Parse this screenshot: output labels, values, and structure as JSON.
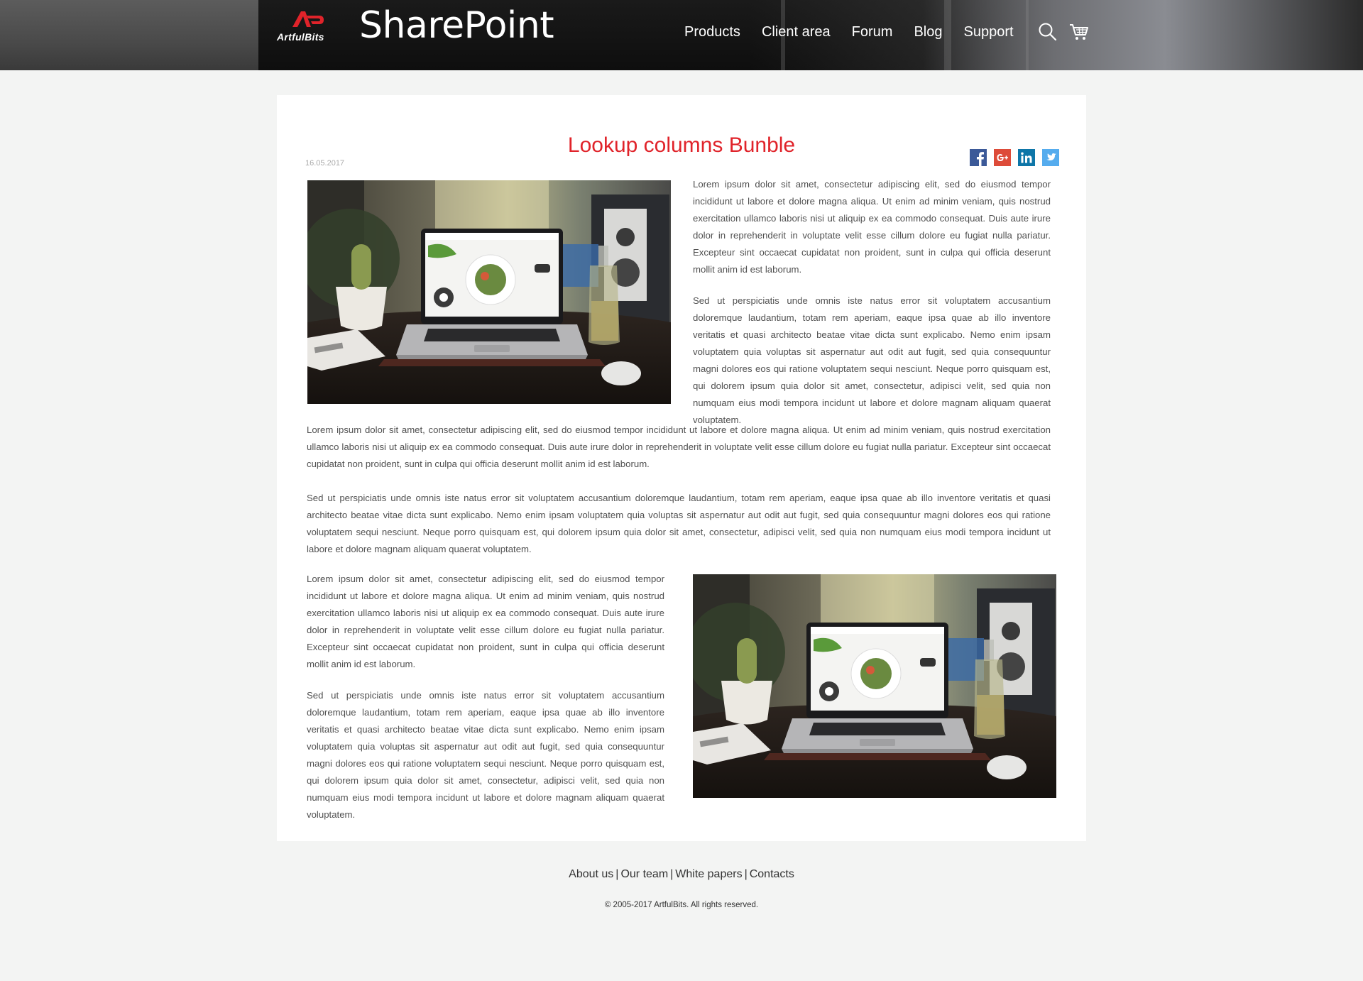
{
  "header": {
    "logo_text": "ArtfulBits",
    "site_title": "SharePoint",
    "nav": [
      "Products",
      "Client area",
      "Forum",
      "Blog",
      "Support"
    ]
  },
  "article": {
    "title": "Lookup columns Bunble",
    "date": "16.05.2017",
    "paragraphs": [
      "Lorem ipsum dolor sit amet, consectetur adipiscing elit, sed do eiusmod tempor incididunt ut labore et dolore magna aliqua. Ut enim ad minim veniam, quis nostrud exercitation ullamco laboris nisi ut aliquip ex ea commodo consequat. Duis aute irure dolor in reprehenderit in voluptate velit esse cillum dolore eu fugiat nulla pariatur. Excepteur sint occaecat cupidatat non proident, sunt in culpa qui officia deserunt mollit anim id est laborum.",
      "Sed ut perspiciatis unde omnis iste natus error sit voluptatem accusantium doloremque laudantium, totam rem aperiam, eaque ipsa quae ab illo inventore veritatis et quasi architecto beatae vitae dicta sunt explicabo. Nemo enim ipsam voluptatem quia voluptas sit aspernatur aut odit aut fugit, sed quia consequuntur magni dolores eos qui ratione voluptatem sequi nesciunt. Neque porro quisquam est, qui dolorem ipsum quia dolor sit amet, consectetur, adipisci velit, sed quia non numquam eius modi tempora incidunt ut labore et dolore magnam aliquam quaerat voluptatem.",
      "Lorem ipsum dolor sit amet, consectetur adipiscing elit, sed do eiusmod tempor incididunt ut labore et dolore magna aliqua. Ut enim ad minim veniam, quis nostrud exercitation ullamco laboris nisi ut aliquip ex ea commodo consequat. Duis aute irure dolor in reprehenderit in voluptate velit esse cillum dolore eu fugiat nulla pariatur. Excepteur sint occaecat cupidatat non proident, sunt in culpa qui officia deserunt mollit anim id est laborum.",
      "Sed ut perspiciatis unde omnis iste natus error sit voluptatem accusantium doloremque laudantium, totam rem aperiam, eaque ipsa quae ab illo inventore veritatis et quasi architecto beatae vitae dicta sunt explicabo. Nemo enim ipsam voluptatem quia voluptas sit aspernatur aut odit aut fugit, sed quia consequuntur magni dolores eos qui ratione voluptatem sequi nesciunt. Neque porro quisquam est, qui dolorem ipsum quia dolor sit amet, consectetur, adipisci velit, sed quia non numquam eius modi tempora incidunt ut labore et dolore magnam aliquam quaerat voluptatem.",
      "Lorem ipsum dolor sit amet, consectetur adipiscing elit, sed do eiusmod tempor incididunt ut labore et dolore magna aliqua. Ut enim ad minim veniam, quis nostrud exercitation ullamco laboris nisi ut aliquip ex ea commodo consequat. Duis aute irure dolor in reprehenderit in voluptate velit esse cillum dolore eu fugiat nulla pariatur. Excepteur sint occaecat cupidatat non proident, sunt in culpa qui officia deserunt mollit anim id est laborum.",
      "Sed ut perspiciatis unde omnis iste natus error sit voluptatem accusantium doloremque laudantium, totam rem aperiam, eaque ipsa quae ab illo inventore veritatis et quasi architecto beatae vitae dicta sunt explicabo. Nemo enim ipsam voluptatem quia voluptas sit aspernatur aut odit aut fugit, sed quia consequuntur magni dolores eos qui ratione voluptatem sequi nesciunt. Neque porro quisquam est, qui dolorem ipsum quia dolor sit amet, consectetur, adipisci velit, sed quia non numquam eius modi tempora incidunt ut labore et dolore magnam aliquam quaerat voluptatem."
    ]
  },
  "share_icons": [
    "facebook-icon",
    "google-plus-icon",
    "linkedin-icon",
    "twitter-icon"
  ],
  "footer": {
    "links": [
      "About us",
      "Our team",
      "White papers",
      "Contacts"
    ],
    "separator": "|",
    "copyright": "© 2005-2017 ArtfulBits. All rights reserved."
  },
  "colors": {
    "accent": "#e0232a",
    "facebook": "#3b5998",
    "google_plus": "#dd4b39",
    "linkedin": "#0e76a8",
    "twitter": "#55acee"
  }
}
